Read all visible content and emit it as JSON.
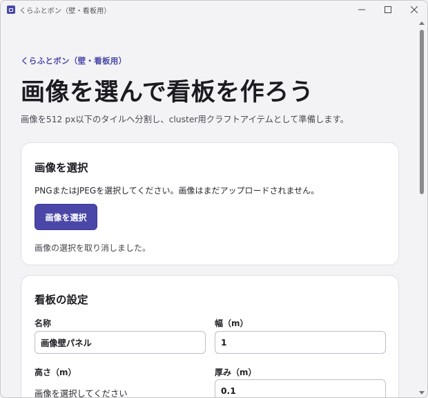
{
  "window": {
    "title": "くらふとボン（壁・看板用）"
  },
  "header": {
    "eyebrow": "くらふとボン（壁・看板用）",
    "title": "画像を選んで看板を作ろう",
    "subtitle": "画像を512 px以下のタイルへ分割し、cluster用クラフトアイテムとして準備します。"
  },
  "image_card": {
    "heading": "画像を選択",
    "description": "PNGまたはJPEGを選択してください。画像はまだアップロードされません。",
    "button_label": "画像を選択",
    "status": "画像の選択を取り消しました。"
  },
  "settings_card": {
    "heading": "看板の設定",
    "name_label": "名称",
    "name_value": "画像壁パネル",
    "width_label": "幅（m）",
    "width_value": "1",
    "height_label": "高さ（m）",
    "height_value": "画像を選択してください",
    "thickness_label": "厚み（m）",
    "thickness_value": "0.1"
  },
  "colors": {
    "accent": "#4a47a8",
    "background": "#f3f3f5",
    "card": "#ffffff"
  }
}
